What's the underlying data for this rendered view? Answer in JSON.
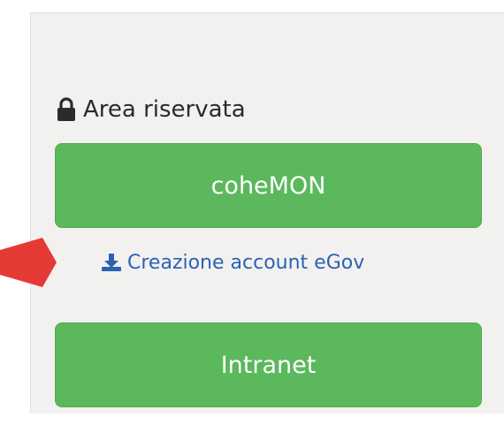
{
  "reserved_area": {
    "title": "Area riservata",
    "title_icon": "lock-icon",
    "primary_button_label": "coheMON",
    "download_link_text": "Creazione account eGov",
    "download_icon": "download-icon",
    "intranet_button_label": "Intranet"
  },
  "annotation": {
    "pointer_icon": "red-arrow-pointer-icon",
    "pointer_color": "#e53935"
  },
  "colors": {
    "panel_bg": "#f3f1ef",
    "button_green": "#5cb85c",
    "link_blue": "#2a62b6",
    "heading_text": "#2b2b2b"
  }
}
